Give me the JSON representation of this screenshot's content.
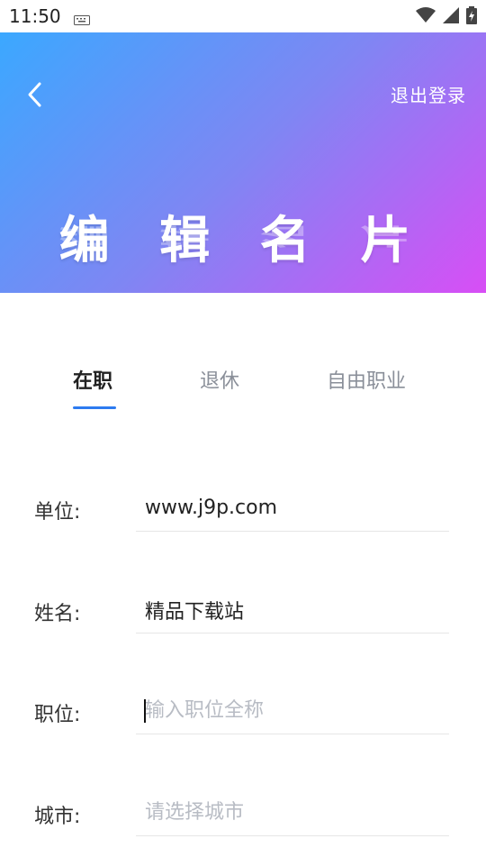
{
  "status_bar": {
    "time": "11:50"
  },
  "header": {
    "logout_label": "退出登录",
    "title": "编 辑 名 片",
    "gradient_colors": [
      "#3ba8ff",
      "#7f86f3",
      "#d84ef5"
    ]
  },
  "tabs": [
    {
      "label": "在职",
      "active": true
    },
    {
      "label": "退休",
      "active": false
    },
    {
      "label": "自由职业",
      "active": false
    }
  ],
  "accent_color": "#2d7bf0",
  "form": {
    "company": {
      "label": "单位:",
      "value": "www.j9p.com"
    },
    "name": {
      "label": "姓名:",
      "value": "精品下载站"
    },
    "position": {
      "label": "职位:",
      "placeholder": "输入职位全称"
    },
    "city": {
      "label": "城市:",
      "placeholder": "请选择城市"
    }
  }
}
